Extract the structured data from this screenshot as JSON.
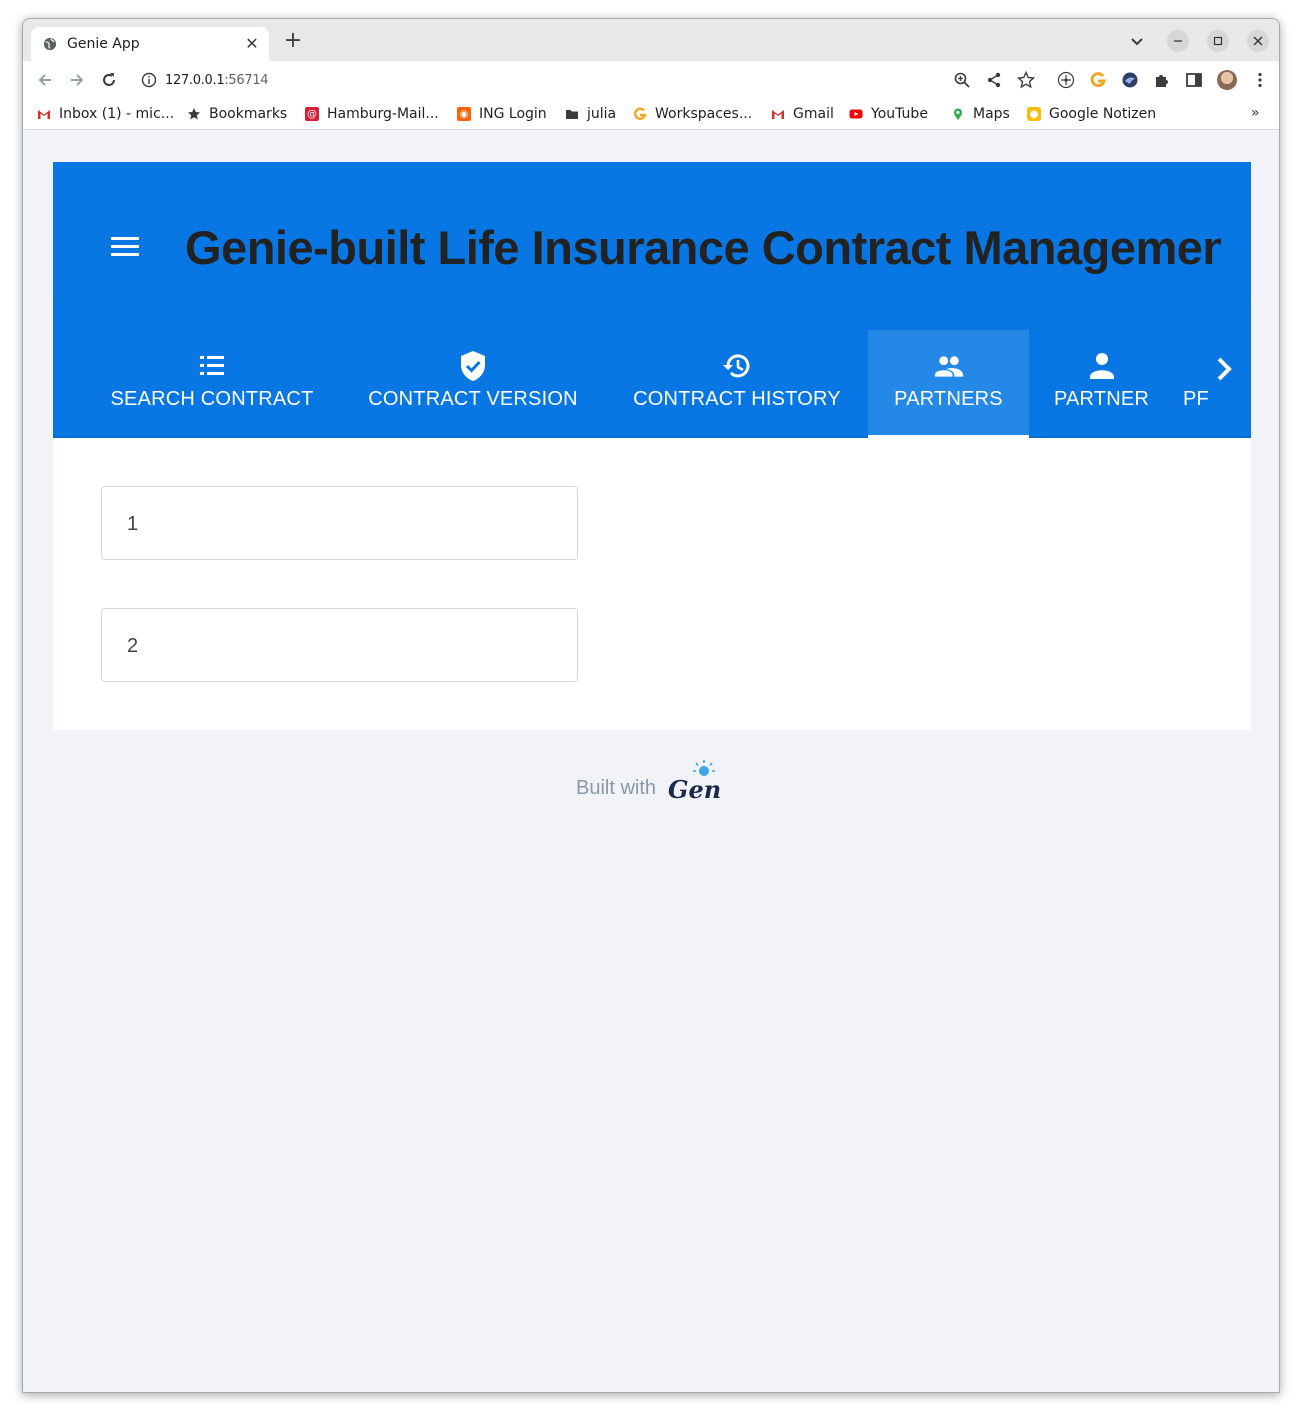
{
  "browser": {
    "tab_title": "Genie App",
    "tab_close": "✕",
    "new_tab": "+",
    "url_host": "127.0.0.1",
    "url_port": ":56714",
    "bookmarks_more": "»"
  },
  "bookmarks": [
    {
      "label": "Inbox (1) - mic...",
      "icon": "gmail-icon",
      "color": "#d93025"
    },
    {
      "label": "Bookmarks",
      "icon": "star-icon",
      "color": "#3c3c3c"
    },
    {
      "label": "Hamburg-Mail...",
      "icon": "at-mail-icon",
      "color": "#d6203a"
    },
    {
      "label": "ING Login",
      "icon": "ing-icon",
      "color": "#ff6200"
    },
    {
      "label": "julia",
      "icon": "folder-icon",
      "color": "#3c3c3c"
    },
    {
      "label": "Workspaces...",
      "icon": "workspaces-icon",
      "color": "#f5a623"
    },
    {
      "label": "Gmail",
      "icon": "gmail-icon",
      "color": "#d93025"
    },
    {
      "label": "YouTube",
      "icon": "youtube-icon",
      "color": "#ff0000"
    },
    {
      "label": "Maps",
      "icon": "maps-pin-icon",
      "color": "#34a853"
    },
    {
      "label": "Google Notizen",
      "icon": "keep-icon",
      "color": "#fbbc04"
    }
  ],
  "app": {
    "title": "Genie-built Life Insurance Contract Management",
    "header_color": "#0877e3",
    "tabs": [
      {
        "label": "SEARCH CONTRACT",
        "icon": "list-icon",
        "active": false
      },
      {
        "label": "CONTRACT VERSION",
        "icon": "verified-shield-icon",
        "active": false
      },
      {
        "label": "CONTRACT HISTORY",
        "icon": "history-icon",
        "active": false
      },
      {
        "label": "PARTNERS",
        "icon": "people-icon",
        "active": true
      },
      {
        "label": "PARTNER",
        "icon": "person-icon",
        "active": false
      },
      {
        "label": "PF",
        "icon": "",
        "active": false
      }
    ],
    "fields": [
      {
        "value": "1"
      },
      {
        "value": "2"
      }
    ]
  },
  "footer": {
    "built_with": "Built with",
    "logo_text": "Genie"
  }
}
